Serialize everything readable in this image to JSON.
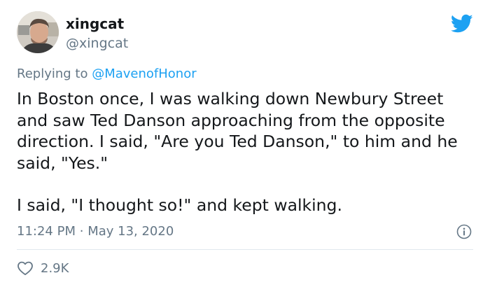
{
  "tweet": {
    "author_name": "xingcat",
    "author_handle": "@xingcat",
    "reply_prefix": "Replying to",
    "reply_to": "@MavenofHonor",
    "paragraphs": [
      "In Boston once, I was walking down Newbury Street and saw Ted Danson approaching from the opposite direction. I said, \"Are you Ted Danson,\" to him and he said, \"Yes.\"",
      "I said, \"I thought so!\" and kept walking."
    ],
    "time": "11:24 PM",
    "separator": "·",
    "date": "May 13, 2020",
    "likes": "2.9K"
  },
  "icons": {
    "brand": "twitter-bird-icon",
    "info": "info-icon",
    "like": "heart-icon"
  },
  "colors": {
    "brand": "#1da1f2",
    "text": "#14171a",
    "secondary": "#657786",
    "divider": "#e1e8ed"
  }
}
